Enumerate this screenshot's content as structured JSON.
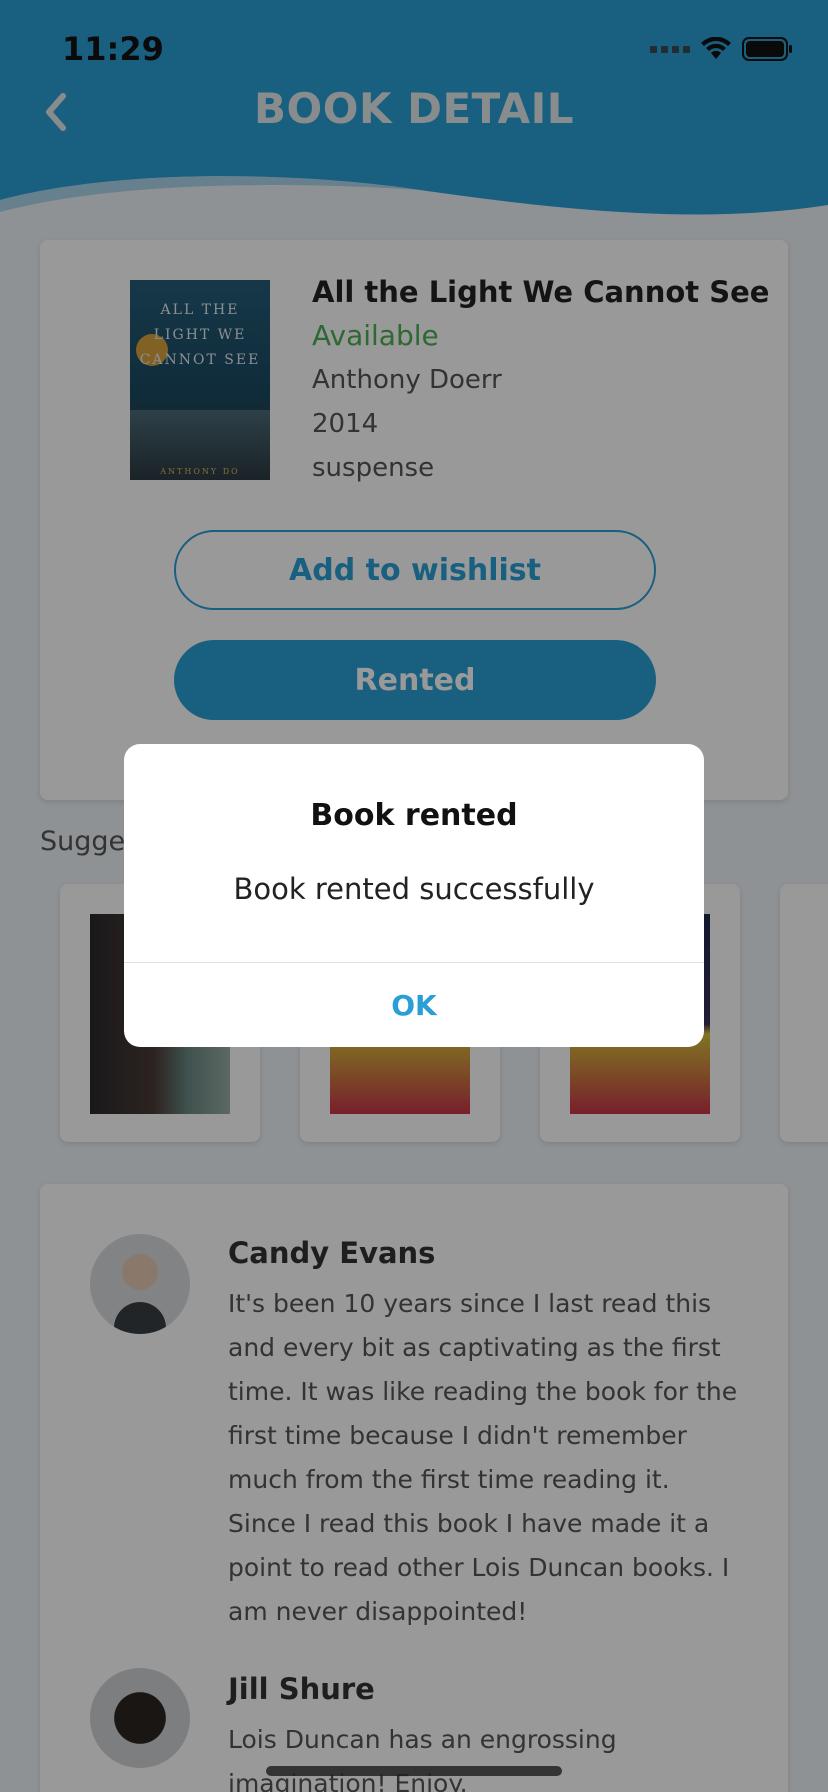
{
  "status_bar": {
    "time": "11:29"
  },
  "header": {
    "title": "BOOK DETAIL",
    "back_icon": "chevron-left-icon"
  },
  "book": {
    "title": "All the Light We Cannot See",
    "status": "Available",
    "author": "Anthony Doerr",
    "year": "2014",
    "genre": "suspense",
    "cover_title": "ALL THE LIGHT WE CANNOT SEE",
    "cover_author": "ANTHONY DO"
  },
  "actions": {
    "wishlist_label": "Add to wishlist",
    "rent_label": "Rented"
  },
  "suggestions": {
    "label": "Sugges"
  },
  "reviews": [
    {
      "name": "Candy Evans",
      "text": "It's been 10 years since I last read this and every bit as captivating as the first time. It was like reading the book for the first time because I didn't remember much from the first time reading it. Since I read this book I have made it a point to read other Lois Duncan books. I am never disappointed!"
    },
    {
      "name": "Jill Shure",
      "text": "Lois Duncan has an engrossing imagination! Enjoy."
    }
  ],
  "dialog": {
    "title": "Book rented",
    "message": "Book rented successfully",
    "ok_label": "OK"
  },
  "colors": {
    "accent": "#2a9fd6",
    "available": "#4caf50",
    "header": "#2a9fd6"
  }
}
